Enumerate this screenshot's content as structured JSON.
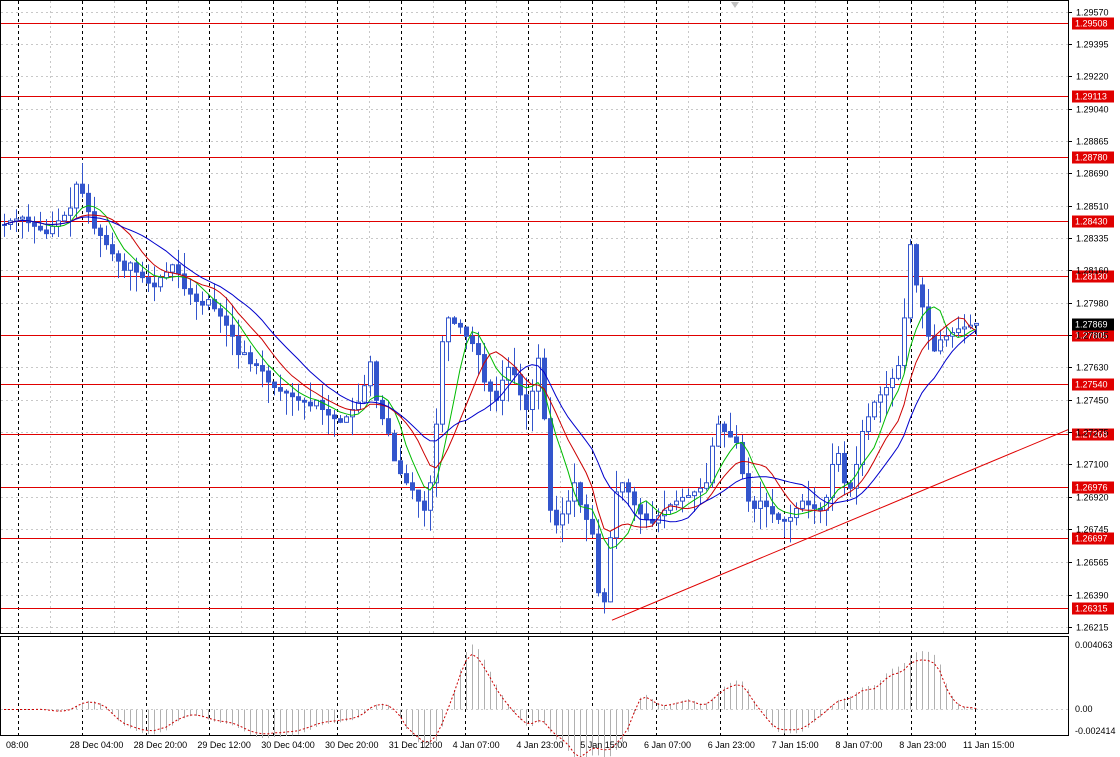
{
  "chart_data": {
    "type": "candlestick",
    "instrument_precision": 5,
    "price_axis": {
      "ticks": [
        "1.29570",
        "1.29395",
        "1.29220",
        "1.29040",
        "1.28865",
        "1.28690",
        "1.28510",
        "1.28335",
        "1.28160",
        "1.27980",
        "1.27805",
        "1.27630",
        "1.27450",
        "1.27275",
        "1.27100",
        "1.26920",
        "1.26745",
        "1.26565",
        "1.26390",
        "1.26215"
      ],
      "ylim": [
        1.2618,
        1.2963
      ]
    },
    "time_axis": {
      "labels": [
        "08:00",
        "28 Dec 04:00",
        "28 Dec 20:00",
        "29 Dec 12:00",
        "30 Dec 04:00",
        "30 Dec 20:00",
        "31 Dec 12:00",
        "4 Jan 07:00",
        "4 Jan 23:00",
        "5 Jan 15:00",
        "6 Jan 07:00",
        "6 Jan 23:00",
        "7 Jan 15:00",
        "8 Jan 07:00",
        "8 Jan 23:00",
        "11 Jan 15:00"
      ]
    },
    "current_price": "1.27869",
    "levels": [
      "1.29508",
      "1.29113",
      "1.28780",
      "1.28430",
      "1.28130",
      "1.27805",
      "1.27540",
      "1.27268",
      "1.26976",
      "1.26697",
      "1.26315"
    ],
    "trendline": {
      "from": {
        "x": 98,
        "y": 1.2625
      },
      "to": {
        "x": 168,
        "y": 1.2729
      }
    },
    "close": [
      1.2841,
      1.2843,
      1.2844,
      1.2845,
      1.2842,
      1.284,
      1.2838,
      1.2836,
      1.284,
      1.2843,
      1.2846,
      1.285,
      1.2863,
      1.2858,
      1.2848,
      1.2839,
      1.2835,
      1.283,
      1.2825,
      1.2821,
      1.2816,
      1.282,
      1.2815,
      1.2812,
      1.2809,
      1.2807,
      1.2812,
      1.2815,
      1.2819,
      1.2814,
      1.2806,
      1.2803,
      1.2799,
      1.2797,
      1.28,
      1.2795,
      1.2791,
      1.2786,
      1.278,
      1.277,
      1.2771,
      1.2765,
      1.2764,
      1.2761,
      1.2755,
      1.2752,
      1.275,
      1.2749,
      1.2747,
      1.2745,
      1.2744,
      1.2742,
      1.2745,
      1.274,
      1.2737,
      1.2735,
      1.2733,
      1.2736,
      1.274,
      1.2744,
      1.2753,
      1.2766,
      1.2745,
      1.2735,
      1.2727,
      1.2712,
      1.2705,
      1.27,
      1.2696,
      1.269,
      1.2685,
      1.27,
      1.2732,
      1.2777,
      1.279,
      1.2787,
      1.2785,
      1.278,
      1.2776,
      1.277,
      1.2755,
      1.275,
      1.2745,
      1.2756,
      1.2763,
      1.2759,
      1.2748,
      1.274,
      1.275,
      1.2768,
      1.2735,
      1.2685,
      1.2677,
      1.2683,
      1.269,
      1.27,
      1.2688,
      1.268,
      1.2672,
      1.264,
      1.2635,
      1.267,
      1.2695,
      1.27,
      1.2695,
      1.2688,
      1.2683,
      1.268,
      1.2678,
      1.2682,
      1.2685,
      1.2688,
      1.269,
      1.2692,
      1.2693,
      1.2695,
      1.2697,
      1.27,
      1.272,
      1.2732,
      1.2728,
      1.2725,
      1.2722,
      1.2705,
      1.269,
      1.2686,
      1.269,
      1.2687,
      1.2683,
      1.268,
      1.2679,
      1.2681,
      1.2686,
      1.269,
      1.2688,
      1.2686,
      1.2685,
      1.2692,
      1.271,
      1.2716,
      1.27,
      1.2697,
      1.271,
      1.2728,
      1.2736,
      1.2744,
      1.2748,
      1.2752,
      1.2757,
      1.2764,
      1.279,
      1.283,
      1.2808,
      1.2796,
      1.278,
      1.2772,
      1.2778,
      1.278,
      1.2782,
      1.2784,
      1.2785,
      1.2786,
      1.2787
    ]
  }
}
